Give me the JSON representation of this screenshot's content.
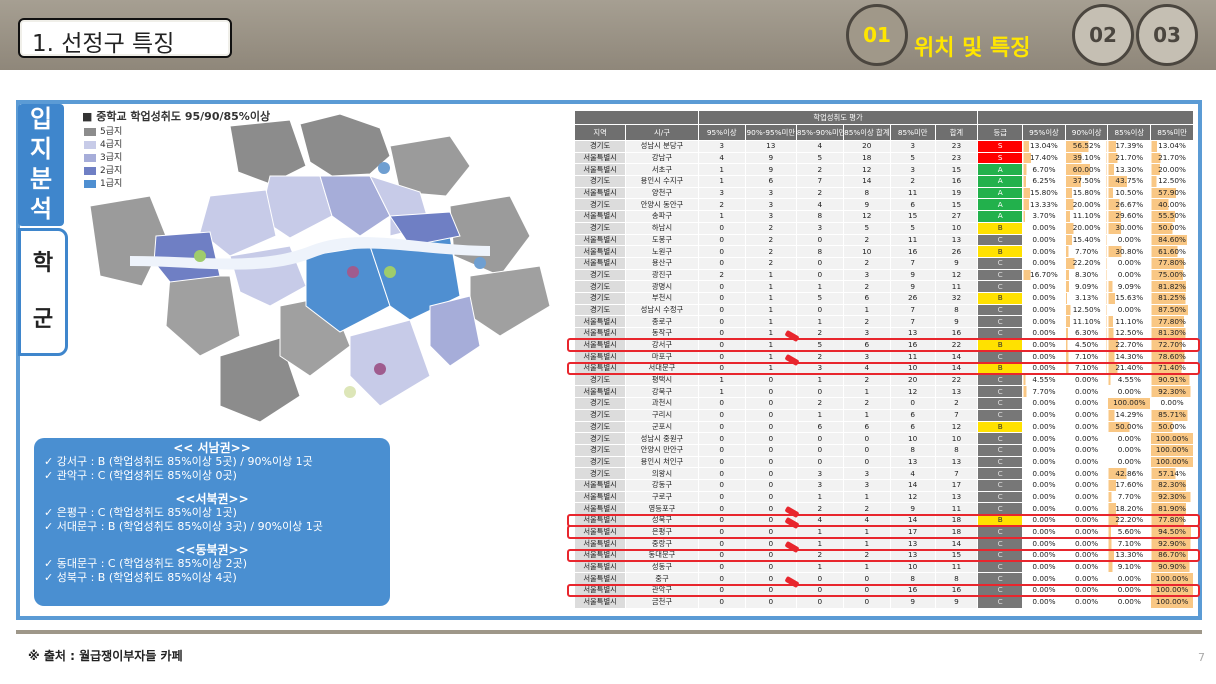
{
  "header": {
    "title": "1. 선정구 특징",
    "steps": [
      "01",
      "02",
      "03"
    ],
    "active_step_title": "위치 및 특징"
  },
  "side_tabs": {
    "tab1": [
      "입",
      "지",
      "분",
      "석"
    ],
    "tab2": [
      "학",
      "군"
    ]
  },
  "map": {
    "legend_title": "■ 중학교 학업성취도 95/90/85%이상",
    "legend": [
      {
        "label": "5급지",
        "color": "#8c8c8c"
      },
      {
        "label": "4급지",
        "color": "#c7cbe8"
      },
      {
        "label": "3급지",
        "color": "#a6add9"
      },
      {
        "label": "2급지",
        "color": "#6f7fc4"
      },
      {
        "label": "1급지",
        "color": "#4f8fd1"
      }
    ]
  },
  "summary": {
    "regions": [
      {
        "title": "<< 서남권>>",
        "items": [
          "✓ 강서구 : B (학업성취도 85%이상 5곳) / 90%이상 1곳",
          "✓ 관악구 : C (학업성취도 85%이상 0곳)"
        ]
      },
      {
        "title": "<<서북권>>",
        "items": [
          "✓ 은평구 : C (학업성취도 85%이상 1곳)",
          "✓ 서대문구 : B (학업성취도 85%이상 3곳) / 90%이상 1곳"
        ]
      },
      {
        "title": "<<동북권>>",
        "items": [
          "✓ 동대문구 : C (학업성취도 85%이상 2곳)",
          "✓ 성북구 : B (학업성취도 85%이상 4곳)"
        ]
      }
    ]
  },
  "table": {
    "group_header": "학업성취도 평가",
    "columns": [
      "지역",
      "시/구",
      "95%이상",
      "90%-95%미만",
      "85%-90%미만",
      "85%이상 합계",
      "85%미만",
      "합계",
      "등급",
      "95%이상",
      "90%이상",
      "85%이상",
      "85%미만"
    ],
    "rows": [
      [
        "경기도",
        "성남시 분당구",
        "3",
        "13",
        "4",
        "20",
        "3",
        "23",
        "S",
        "13.04%",
        "56.52%",
        "17.39%",
        "13.04%"
      ],
      [
        "서울특별시",
        "강남구",
        "4",
        "9",
        "5",
        "18",
        "5",
        "23",
        "S",
        "17.40%",
        "39.10%",
        "21.70%",
        "21.70%"
      ],
      [
        "서울특별시",
        "서초구",
        "1",
        "9",
        "2",
        "12",
        "3",
        "15",
        "A",
        "6.70%",
        "60.00%",
        "13.30%",
        "20.00%"
      ],
      [
        "경기도",
        "용인시 수지구",
        "1",
        "6",
        "7",
        "14",
        "2",
        "16",
        "A",
        "6.25%",
        "37.50%",
        "43.75%",
        "12.50%"
      ],
      [
        "서울특별시",
        "양천구",
        "3",
        "3",
        "2",
        "8",
        "11",
        "19",
        "A",
        "15.80%",
        "15.80%",
        "10.50%",
        "57.90%"
      ],
      [
        "경기도",
        "안양시 동안구",
        "2",
        "3",
        "4",
        "9",
        "6",
        "15",
        "A",
        "13.33%",
        "20.00%",
        "26.67%",
        "40.00%"
      ],
      [
        "서울특별시",
        "송파구",
        "1",
        "3",
        "8",
        "12",
        "15",
        "27",
        "A",
        "3.70%",
        "11.10%",
        "29.60%",
        "55.50%"
      ],
      [
        "경기도",
        "하남시",
        "0",
        "2",
        "3",
        "5",
        "5",
        "10",
        "B",
        "0.00%",
        "20.00%",
        "30.00%",
        "50.00%"
      ],
      [
        "서울특별시",
        "도봉구",
        "0",
        "2",
        "0",
        "2",
        "11",
        "13",
        "C",
        "0.00%",
        "15.40%",
        "0.00%",
        "84.60%"
      ],
      [
        "서울특별시",
        "노원구",
        "0",
        "2",
        "8",
        "10",
        "16",
        "26",
        "B",
        "0.00%",
        "7.70%",
        "30.80%",
        "61.60%"
      ],
      [
        "서울특별시",
        "용산구",
        "0",
        "2",
        "0",
        "2",
        "7",
        "9",
        "C",
        "0.00%",
        "22.20%",
        "0.00%",
        "77.80%"
      ],
      [
        "경기도",
        "광진구",
        "2",
        "1",
        "0",
        "3",
        "9",
        "12",
        "C",
        "16.70%",
        "8.30%",
        "0.00%",
        "75.00%"
      ],
      [
        "경기도",
        "광명시",
        "0",
        "1",
        "1",
        "2",
        "9",
        "11",
        "C",
        "0.00%",
        "9.09%",
        "9.09%",
        "81.82%"
      ],
      [
        "경기도",
        "부천시",
        "0",
        "1",
        "5",
        "6",
        "26",
        "32",
        "B",
        "0.00%",
        "3.13%",
        "15.63%",
        "81.25%"
      ],
      [
        "경기도",
        "성남시 수정구",
        "0",
        "1",
        "0",
        "1",
        "7",
        "8",
        "C",
        "0.00%",
        "12.50%",
        "0.00%",
        "87.50%"
      ],
      [
        "서울특별시",
        "종로구",
        "0",
        "1",
        "1",
        "2",
        "7",
        "9",
        "C",
        "0.00%",
        "11.10%",
        "11.10%",
        "77.80%"
      ],
      [
        "서울특별시",
        "동작구",
        "0",
        "1",
        "2",
        "3",
        "13",
        "16",
        "C",
        "0.00%",
        "6.30%",
        "12.50%",
        "81.30%"
      ],
      [
        "서울특별시",
        "강서구",
        "0",
        "1",
        "5",
        "6",
        "16",
        "22",
        "B",
        "0.00%",
        "4.50%",
        "22.70%",
        "72.70%"
      ],
      [
        "서울특별시",
        "마포구",
        "0",
        "1",
        "2",
        "3",
        "11",
        "14",
        "C",
        "0.00%",
        "7.10%",
        "14.30%",
        "78.60%"
      ],
      [
        "서울특별시",
        "서대문구",
        "0",
        "1",
        "3",
        "4",
        "10",
        "14",
        "B",
        "0.00%",
        "7.10%",
        "21.40%",
        "71.40%"
      ],
      [
        "경기도",
        "평택시",
        "1",
        "0",
        "1",
        "2",
        "20",
        "22",
        "C",
        "4.55%",
        "0.00%",
        "4.55%",
        "90.91%"
      ],
      [
        "서울특별시",
        "강북구",
        "1",
        "0",
        "0",
        "1",
        "12",
        "13",
        "C",
        "7.70%",
        "0.00%",
        "0.00%",
        "92.30%"
      ],
      [
        "경기도",
        "과천시",
        "0",
        "0",
        "2",
        "2",
        "0",
        "2",
        "C",
        "0.00%",
        "0.00%",
        "100.00%",
        "0.00%"
      ],
      [
        "경기도",
        "구리시",
        "0",
        "0",
        "1",
        "1",
        "6",
        "7",
        "C",
        "0.00%",
        "0.00%",
        "14.29%",
        "85.71%"
      ],
      [
        "경기도",
        "군포시",
        "0",
        "0",
        "6",
        "6",
        "6",
        "12",
        "B",
        "0.00%",
        "0.00%",
        "50.00%",
        "50.00%"
      ],
      [
        "경기도",
        "성남시 중원구",
        "0",
        "0",
        "0",
        "0",
        "10",
        "10",
        "C",
        "0.00%",
        "0.00%",
        "0.00%",
        "100.00%"
      ],
      [
        "경기도",
        "안양시 만안구",
        "0",
        "0",
        "0",
        "0",
        "8",
        "8",
        "C",
        "0.00%",
        "0.00%",
        "0.00%",
        "100.00%"
      ],
      [
        "경기도",
        "용인시 처인구",
        "0",
        "0",
        "0",
        "0",
        "13",
        "13",
        "C",
        "0.00%",
        "0.00%",
        "0.00%",
        "100.00%"
      ],
      [
        "경기도",
        "의왕시",
        "0",
        "0",
        "3",
        "3",
        "4",
        "7",
        "C",
        "0.00%",
        "0.00%",
        "42.86%",
        "57.14%"
      ],
      [
        "서울특별시",
        "강동구",
        "0",
        "0",
        "3",
        "3",
        "14",
        "17",
        "C",
        "0.00%",
        "0.00%",
        "17.60%",
        "82.30%"
      ],
      [
        "서울특별시",
        "구로구",
        "0",
        "0",
        "1",
        "1",
        "12",
        "13",
        "C",
        "0.00%",
        "0.00%",
        "7.70%",
        "92.30%"
      ],
      [
        "서울특별시",
        "영등포구",
        "0",
        "0",
        "2",
        "2",
        "9",
        "11",
        "C",
        "0.00%",
        "0.00%",
        "18.20%",
        "81.90%"
      ],
      [
        "서울특별시",
        "성북구",
        "0",
        "0",
        "4",
        "4",
        "14",
        "18",
        "B",
        "0.00%",
        "0.00%",
        "22.20%",
        "77.80%"
      ],
      [
        "서울특별시",
        "은평구",
        "0",
        "0",
        "1",
        "1",
        "17",
        "18",
        "C",
        "0.00%",
        "0.00%",
        "5.60%",
        "94.50%"
      ],
      [
        "서울특별시",
        "중랑구",
        "0",
        "0",
        "1",
        "1",
        "13",
        "14",
        "C",
        "0.00%",
        "0.00%",
        "7.10%",
        "92.90%"
      ],
      [
        "서울특별시",
        "동대문구",
        "0",
        "0",
        "2",
        "2",
        "13",
        "15",
        "C",
        "0.00%",
        "0.00%",
        "13.30%",
        "86.70%"
      ],
      [
        "서울특별시",
        "성동구",
        "0",
        "0",
        "1",
        "1",
        "10",
        "11",
        "C",
        "0.00%",
        "0.00%",
        "9.10%",
        "90.90%"
      ],
      [
        "서울특별시",
        "중구",
        "0",
        "0",
        "0",
        "0",
        "8",
        "8",
        "C",
        "0.00%",
        "0.00%",
        "0.00%",
        "100.00%"
      ],
      [
        "서울특별시",
        "관악구",
        "0",
        "0",
        "0",
        "0",
        "16",
        "16",
        "C",
        "0.00%",
        "0.00%",
        "0.00%",
        "100.00%"
      ],
      [
        "서울특별시",
        "금천구",
        "0",
        "0",
        "0",
        "0",
        "9",
        "9",
        "C",
        "0.00%",
        "0.00%",
        "0.00%",
        "100.00%"
      ]
    ],
    "highlighted_districts": [
      "강서구",
      "서대문구",
      "성북구",
      "은평구",
      "동대문구",
      "관악구"
    ]
  },
  "footer": {
    "source": "※ 출처 : 월급쟁이부자들 카페",
    "page_number": "7"
  },
  "colors": {
    "accent_blue": "#3f86cc",
    "header_band": "#8f877a",
    "highlight_red": "#e8262d",
    "grade_S": "#ff0000",
    "grade_A": "#22b14c",
    "grade_B": "#ffe100",
    "grade_C": "#777777"
  }
}
